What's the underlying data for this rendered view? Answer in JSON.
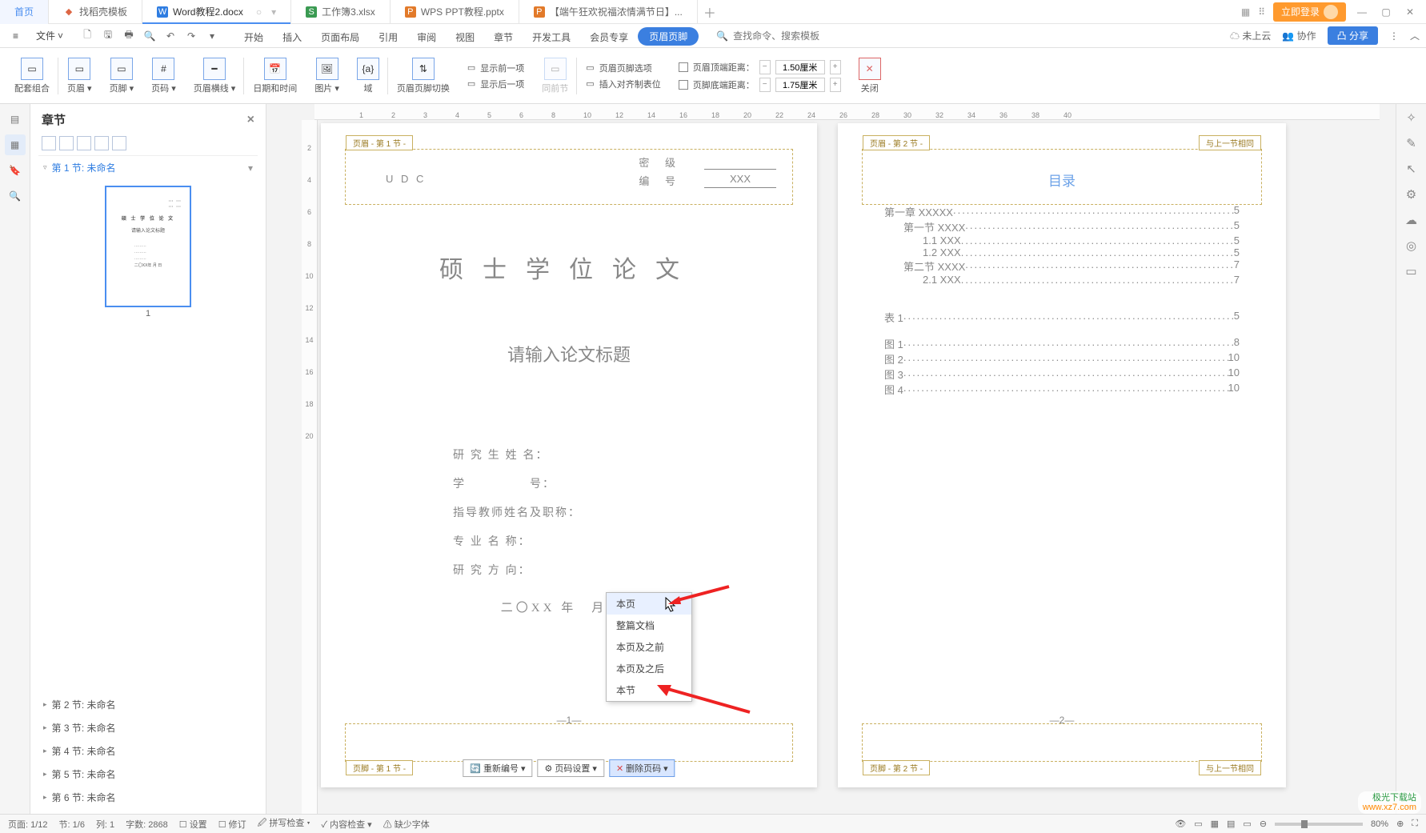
{
  "titlebar": {
    "tabs": [
      {
        "label": "首页",
        "icon": ""
      },
      {
        "label": "找稻壳模板",
        "icon": "◆",
        "color": "#d64"
      },
      {
        "label": "Word教程2.docx",
        "icon": "W",
        "color": "#2f7de1",
        "active": true
      },
      {
        "label": "工作簿3.xlsx",
        "icon": "S",
        "color": "#3a9a52"
      },
      {
        "label": "WPS PPT教程.pptx",
        "icon": "P",
        "color": "#e27a2a"
      },
      {
        "label": "【端午狂欢祝福浓情满节日】...",
        "icon": "P",
        "color": "#e27a2a"
      }
    ],
    "login": "立即登录"
  },
  "menubar": {
    "file": "文件",
    "tabs": [
      "开始",
      "插入",
      "页面布局",
      "引用",
      "审阅",
      "视图",
      "章节",
      "开发工具",
      "会员专享",
      "页眉页脚"
    ],
    "active": 9,
    "search_placeholder": "查找命令、搜索模板",
    "cloud": "未上云",
    "coop": "协作",
    "share": "分享"
  },
  "ribbon": {
    "g1": "配套组合",
    "g2": "页眉",
    "g3": "页脚",
    "g4": "页码",
    "g5": "页眉横线",
    "g6": "日期和时间",
    "g7": "图片",
    "g8": "域",
    "g9": "页眉页脚切换",
    "g10a": "显示前一项",
    "g10b": "显示后一项",
    "g11": "同前节",
    "g12": "页眉页脚选项",
    "g13": "插入对齐制表位",
    "g14a": "页眉顶端距离：",
    "g14b": "页脚底端距离：",
    "val1": "1.50厘米",
    "val2": "1.75厘米",
    "g15": "关闭"
  },
  "sidepanel": {
    "title": "章节",
    "current": "第 1 节: 未命名",
    "pgnum": "1",
    "sections": [
      "第 2 节: 未命名",
      "第 3 节: 未命名",
      "第 4 节: 未命名",
      "第 5 节: 未命名",
      "第 6 节: 未命名"
    ]
  },
  "page1": {
    "hdr_tag": "页眉 - 第 1 节 -",
    "ftr_tag": "页脚 - 第 1 节 -",
    "meta": [
      [
        "密  级",
        ""
      ],
      [
        "U D C",
        ""
      ],
      [
        "编  号",
        "XXX"
      ]
    ],
    "title": "硕士学位论文",
    "subtitle": "请输入论文标题",
    "fields": [
      "研 究 生 姓 名：",
      "学　　　　　号：",
      "指导教师姓名及职称：",
      "专  业  名  称：",
      "研  究  方  向："
    ],
    "date": "二〇XX 年　月　日",
    "pgnum": "—1—"
  },
  "ctx": {
    "items": [
      "本页",
      "整篇文档",
      "本页及之前",
      "本页及之后",
      "本节"
    ],
    "hover": 0
  },
  "ftr_tools": {
    "b1": "重新编号",
    "b2": "页码设置",
    "b3": "删除页码"
  },
  "page2": {
    "hdr_tag": "页眉 - 第 2 节 -",
    "ftr_tag": "页脚 - 第 2 节 -",
    "link": "与上一节相同",
    "title": "目录",
    "pgnum": "—2—",
    "toc": [
      {
        "t": "第一章  XXXXX",
        "p": "5",
        "l": 1
      },
      {
        "t": "第一节  XXXX",
        "p": "5",
        "l": 2
      },
      {
        "t": "1.1 XXX",
        "p": "5",
        "l": 3
      },
      {
        "t": "1.2 XXX",
        "p": "5",
        "l": 3
      },
      {
        "t": "第二节  XXXX",
        "p": "7",
        "l": 2
      },
      {
        "t": "2.1 XXX",
        "p": "7",
        "l": 3
      }
    ],
    "tables": [
      {
        "t": "表 1",
        "p": "5"
      }
    ],
    "figs": [
      {
        "t": "图 1",
        "p": "8"
      },
      {
        "t": "图 2",
        "p": "10"
      },
      {
        "t": "图 3",
        "p": "10"
      },
      {
        "t": "图 4",
        "p": "10"
      }
    ]
  },
  "statusbar": {
    "page": "页面: 1/12",
    "sec": "节: 1/6",
    "col": "列: 1",
    "words": "字数: 2868",
    "cb1": "设置",
    "cb2": "修订",
    "spell": "拼写检查",
    "content": "内容检查",
    "fonts": "缺少字体",
    "zoom": "80%"
  },
  "watermark": {
    "l1": "极光下载站",
    "l2": "www.xz7.com"
  }
}
